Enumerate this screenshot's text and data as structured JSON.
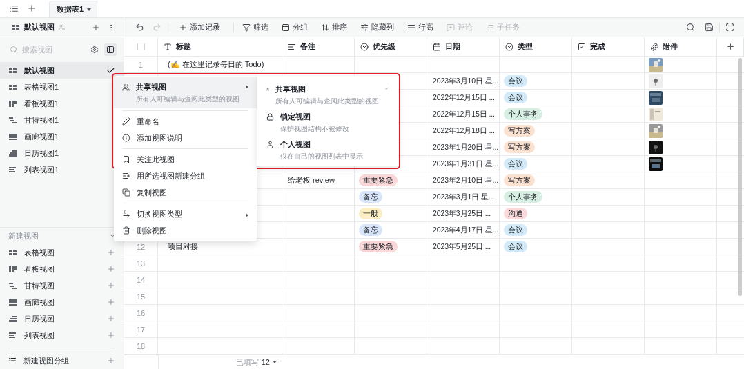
{
  "top_tabs": {
    "tabs": [
      {
        "label": "数据表1",
        "selected": true
      }
    ]
  },
  "toolbar": {
    "view_name": "默认视图",
    "history": [
      {
        "disabled": false
      },
      {
        "disabled": true
      }
    ],
    "actions": [
      {
        "label": "添加记录",
        "disabled": false
      },
      {
        "label": "筛选",
        "disabled": false
      },
      {
        "label": "分组",
        "disabled": false
      },
      {
        "label": "排序",
        "disabled": false
      },
      {
        "label": "隐藏列",
        "disabled": false
      },
      {
        "label": "行高",
        "disabled": false
      },
      {
        "label": "评论",
        "disabled": true
      },
      {
        "label": "子任务",
        "disabled": true
      }
    ]
  },
  "sidebar": {
    "search": {
      "placeholder": "搜索视图"
    },
    "views": [
      {
        "label": "默认视图",
        "kind": "grid",
        "selected": true
      },
      {
        "label": "表格视图1",
        "kind": "grid",
        "selected": false
      },
      {
        "label": "看板视图1",
        "kind": "kanban",
        "selected": false
      },
      {
        "label": "甘特视图1",
        "kind": "gantt",
        "selected": false
      },
      {
        "label": "画廊视图1",
        "kind": "gallery",
        "selected": false
      },
      {
        "label": "日历视图1",
        "kind": "calendar",
        "selected": false
      },
      {
        "label": "列表视图1",
        "kind": "list",
        "selected": false
      }
    ],
    "new_view": {
      "title": "新建视图",
      "items": [
        {
          "label": "表格视图",
          "kind": "grid"
        },
        {
          "label": "看板视图",
          "kind": "kanban"
        },
        {
          "label": "甘特视图",
          "kind": "gantt"
        },
        {
          "label": "画廊视图",
          "kind": "gallery"
        },
        {
          "label": "日历视图",
          "kind": "calendar"
        },
        {
          "label": "列表视图",
          "kind": "list"
        }
      ]
    },
    "new_group": "新建视图分组"
  },
  "table": {
    "select_all": {
      "checked": false
    },
    "columns": [
      {
        "label": "标题",
        "kind": "text"
      },
      {
        "label": "备注",
        "kind": "longtext"
      },
      {
        "label": "优先级",
        "kind": "select"
      },
      {
        "label": "日期",
        "kind": "date"
      },
      {
        "label": "类型",
        "kind": "select"
      },
      {
        "label": "完成",
        "kind": "checkbox"
      },
      {
        "label": "附件",
        "kind": "attachment"
      }
    ],
    "rows": [
      {
        "number": "1",
        "title": "(✍️ 在这里记录每日的 Todo)"
      },
      {
        "date": "2023年3月10日 星...",
        "type": {
          "label": "会议",
          "color": "#d3eaf8"
        }
      },
      {
        "date": "2022年12月15日 ...",
        "type": {
          "label": "会议",
          "color": "#d3eaf8"
        }
      },
      {
        "date": "2022年12月15日 ...",
        "type": {
          "label": "个人事务",
          "color": "#d6efe2"
        }
      },
      {
        "date": "2022年12月18日 ...",
        "type": {
          "label": "写方案",
          "color": "#fbe1d0"
        }
      },
      {
        "date": "2023年1月20日 星...",
        "type": {
          "label": "写方案",
          "color": "#fbe1d0"
        }
      },
      {
        "date": "2023年1月31日 星...",
        "type": {
          "label": "会议",
          "color": "#d3eaf8"
        }
      },
      {
        "note": "给老板 review",
        "priority": {
          "label": "重要紧急",
          "color": "#f9d7d8"
        },
        "date": "2023年2月10日 星...",
        "type": {
          "label": "写方案",
          "color": "#fbe1d0"
        }
      },
      {
        "priority": {
          "label": "备忘",
          "color": "#d8e5fb"
        },
        "date": "2023年3月1日 星...",
        "type": {
          "label": "个人事务",
          "color": "#d6efe2"
        }
      },
      {
        "priority": {
          "label": "一般",
          "color": "#fbeec3"
        },
        "date": "2023年3月25日 ...",
        "type": {
          "label": "沟通",
          "color": "#fadadb"
        }
      },
      {
        "priority": {
          "label": "备忘",
          "color": "#d8e5fb"
        },
        "date": "2023年4月17日 星...",
        "type": {
          "label": "会议",
          "color": "#d3eaf8"
        }
      },
      {
        "number": "12",
        "title": "项目对接",
        "priority": {
          "label": "重要紧急",
          "color": "#f9d7d8"
        },
        "date": "2023年5月25日 ...",
        "type": {
          "label": "会议",
          "color": "#d3eaf8"
        }
      },
      {
        "number": "13"
      },
      {
        "number": "14"
      },
      {
        "number": "15"
      },
      {
        "number": "16"
      },
      {
        "number": "17"
      },
      {
        "number": "18"
      }
    ],
    "footer": {
      "label": "已填写",
      "count": "12"
    }
  },
  "context_menu": {
    "items": [
      {
        "kind": "item",
        "label": "共享视图",
        "description": "所有人可编辑与查阅此类型的视图",
        "submenu": true,
        "highlighted": true
      },
      {
        "kind": "divider"
      },
      {
        "kind": "item",
        "label": "重命名",
        "submenu": false,
        "highlighted": false
      },
      {
        "kind": "item",
        "label": "添加视图说明",
        "submenu": false,
        "highlighted": false
      },
      {
        "kind": "divider"
      },
      {
        "kind": "item",
        "label": "关注此视图",
        "submenu": false,
        "highlighted": false
      },
      {
        "kind": "item",
        "label": "用所选视图新建分组",
        "submenu": false,
        "highlighted": false
      },
      {
        "kind": "item",
        "label": "复制视图",
        "submenu": false,
        "highlighted": false
      },
      {
        "kind": "divider"
      },
      {
        "kind": "item",
        "label": "切换视图类型",
        "submenu": true,
        "highlighted": false
      },
      {
        "kind": "item",
        "label": "删除视图",
        "submenu": false,
        "highlighted": false
      }
    ]
  },
  "submenu": {
    "items": [
      {
        "label": "共享视图",
        "description": "所有人可编辑与查阅此类型的视图",
        "selected": true
      },
      {
        "label": "锁定视图",
        "description": "保护视图结构不被修改",
        "selected": false
      },
      {
        "label": "个人视图",
        "description": "仅在自己的视图列表中显示",
        "selected": false
      }
    ]
  }
}
